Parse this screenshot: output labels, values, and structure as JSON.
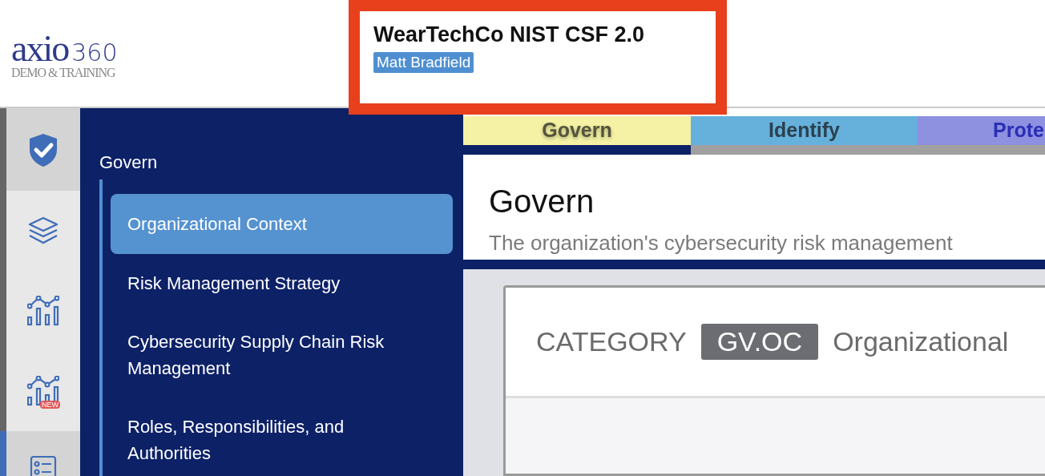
{
  "header": {
    "logo": {
      "brand": "axio",
      "number": "360",
      "subtitle": "DEMO & TRAINING"
    },
    "title": "WearTechCo NIST CSF 2.0",
    "user": "Matt Bradfield"
  },
  "rail_items": [
    {
      "kind": "shield",
      "selected": false
    },
    {
      "kind": "layers",
      "selected": false
    },
    {
      "kind": "chart",
      "selected": false
    },
    {
      "kind": "chart-new",
      "badge": "NEW",
      "selected": false
    },
    {
      "kind": "list",
      "selected": true
    }
  ],
  "nav": {
    "heading": "Govern",
    "items": [
      {
        "label": "Organizational Context",
        "selected": true
      },
      {
        "label": "Risk Management Strategy",
        "selected": false
      },
      {
        "label": "Cybersecurity Supply Chain Risk Management",
        "selected": false
      },
      {
        "label": "Roles, Responsibilities, and Authorities",
        "selected": false
      }
    ]
  },
  "tabs": [
    {
      "label": "Govern",
      "selected": true,
      "color": "#f5f2a5"
    },
    {
      "label": "Identify",
      "selected": false,
      "color": "#66b0dc"
    },
    {
      "label": "Prote",
      "selected": false,
      "color": "#8e90e0"
    }
  ],
  "section": {
    "title": "Govern",
    "description": "The organization's cybersecurity risk management"
  },
  "category": {
    "label": "CATEGORY",
    "code": "GV.OC",
    "name": "Organizational"
  }
}
